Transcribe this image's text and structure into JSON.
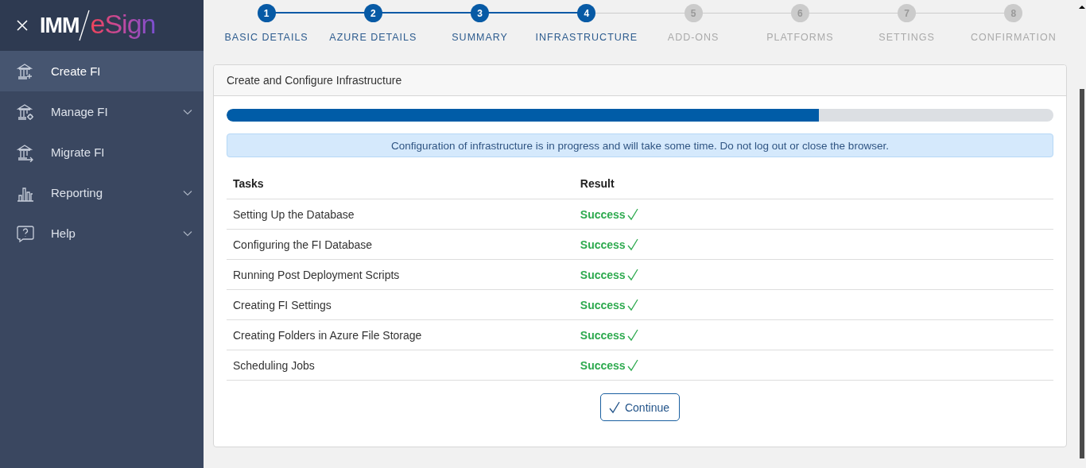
{
  "sidebar": {
    "logo": {
      "part1": "IMM",
      "part2": "eSign"
    },
    "items": [
      {
        "label": "Create FI",
        "kind": "create",
        "selected": true,
        "expandable": false
      },
      {
        "label": "Manage FI",
        "kind": "manage",
        "selected": false,
        "expandable": true
      },
      {
        "label": "Migrate FI",
        "kind": "migrate",
        "selected": false,
        "expandable": false
      },
      {
        "label": "Reporting",
        "kind": "report",
        "selected": false,
        "expandable": true
      },
      {
        "label": "Help",
        "kind": "help",
        "selected": false,
        "expandable": true
      }
    ]
  },
  "stepper": [
    {
      "number": "1",
      "label": "BASIC DETAILS",
      "completed": true
    },
    {
      "number": "2",
      "label": "AZURE DETAILS",
      "completed": true
    },
    {
      "number": "3",
      "label": "SUMMARY",
      "completed": true
    },
    {
      "number": "4",
      "label": "INFRASTRUCTURE",
      "completed": true
    },
    {
      "number": "5",
      "label": "ADD-ONS",
      "completed": false
    },
    {
      "number": "6",
      "label": "PLATFORMS",
      "completed": false
    },
    {
      "number": "7",
      "label": "SETTINGS",
      "completed": false
    },
    {
      "number": "8",
      "label": "CONFIRMATION",
      "completed": false
    }
  ],
  "card": {
    "title": "Create and Configure Infrastructure",
    "progress": {
      "level": 0.716
    },
    "alert": "Configuration of infrastructure is in progress and will take some time. Do not log out or close the browser.",
    "table": {
      "columns": [
        "Tasks",
        "Result"
      ],
      "rows": [
        {
          "task": "Setting Up the Database",
          "result": "Success"
        },
        {
          "task": "Configuring the FI Database",
          "result": "Success"
        },
        {
          "task": "Running Post Deployment Scripts",
          "result": "Success"
        },
        {
          "task": "Creating FI Settings",
          "result": "Success"
        },
        {
          "task": "Creating Folders in Azure File Storage",
          "result": "Success"
        },
        {
          "task": "Scheduling Jobs",
          "result": "Success"
        }
      ]
    },
    "button": "Continue"
  }
}
